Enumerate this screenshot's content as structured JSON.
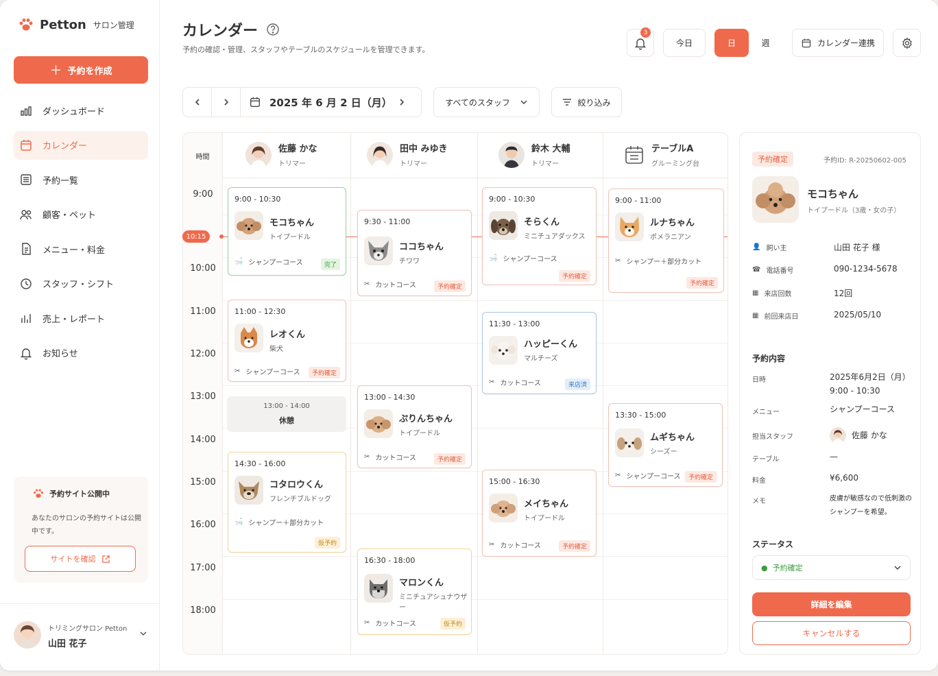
{
  "sidebar": {
    "brand": "Petton",
    "brand_sub": "サロン管理",
    "new_button": "予約を作成",
    "nav": [
      {
        "label": "ダッシュボード"
      },
      {
        "label": "カレンダー"
      },
      {
        "label": "予約一覧"
      },
      {
        "label": "顧客・ペット"
      },
      {
        "label": "メニュー・料金"
      },
      {
        "label": "スタッフ・シフト"
      },
      {
        "label": "売上・レポート"
      },
      {
        "label": "お知らせ"
      }
    ],
    "promo": {
      "title": "予約サイト公開中",
      "desc": "あなたのサロンの予約サイトは公開中です。",
      "button": "サイトを確認"
    },
    "user": {
      "salon": "トリミングサロン Petton",
      "name": "山田 花子"
    }
  },
  "header": {
    "title": "カレンダー",
    "subtitle": "予約の確認・管理、スタッフやテーブルのスケジュールを管理できます。",
    "notif_count": "3",
    "today": "今日",
    "view_day": "日",
    "view_week": "週",
    "calendar_sync": "カレンダー連携"
  },
  "toolbar": {
    "date": "2025 年 6 月 2 日（月）",
    "staff_filter": "すべてのスタッフ",
    "filter": "絞り込み"
  },
  "calendar": {
    "time_header": "時間",
    "now_label": "10:15",
    "times": [
      "9:00",
      "10:00",
      "11:00",
      "12:00",
      "13:00",
      "14:00",
      "15:00",
      "16:00",
      "17:00",
      "18:00"
    ],
    "columns": [
      {
        "name": "佐藤 かな",
        "role": "トリマー"
      },
      {
        "name": "田中 みゆき",
        "role": "トリマー"
      },
      {
        "name": "鈴木 大輔",
        "role": "トリマー"
      },
      {
        "name": "テーブルA",
        "role": "グルーミング台"
      }
    ],
    "break": {
      "time": "13:00 - 14:00",
      "label": "休憩"
    },
    "events": [
      {
        "time": "9:00 - 10:30",
        "pet": "モコちゃん",
        "breed": "トイプードル",
        "menu": "シャンプーコース",
        "status": "完了"
      },
      {
        "time": "11:00 - 12:30",
        "pet": "レオくん",
        "breed": "柴犬",
        "menu": "シャンプーコース",
        "status": "予約確定"
      },
      {
        "time": "14:30 - 16:00",
        "pet": "コタロウくん",
        "breed": "フレンチブルドッグ",
        "menu": "シャンプー＋部分カット",
        "status": "仮予約"
      },
      {
        "time": "9:30 - 11:00",
        "pet": "ココちゃん",
        "breed": "チワワ",
        "menu": "カットコース",
        "status": "予約確定"
      },
      {
        "time": "13:00 - 14:30",
        "pet": "ぷりんちゃん",
        "breed": "トイプードル",
        "menu": "カットコース",
        "status": "予約確定"
      },
      {
        "time": "16:30 - 18:00",
        "pet": "マロンくん",
        "breed": "ミニチュアシュナウザー",
        "menu": "カットコース",
        "status": "仮予約"
      },
      {
        "time": "9:00 - 10:30",
        "pet": "そらくん",
        "breed": "ミニチュアダックス",
        "menu": "シャンプーコース",
        "status": "予約確定"
      },
      {
        "time": "11:30 - 13:00",
        "pet": "ハッピーくん",
        "breed": "マルチーズ",
        "menu": "カットコース",
        "status": "来店済"
      },
      {
        "time": "15:00 - 16:30",
        "pet": "メイちゃん",
        "breed": "トイプードル",
        "menu": "カットコース",
        "status": "予約確定"
      },
      {
        "time": "9:00 - 11:00",
        "pet": "ルナちゃん",
        "breed": "ポメラニアン",
        "menu": "シャンプー＋部分カット",
        "status": "予約確定"
      },
      {
        "time": "13:30 - 15:00",
        "pet": "ムギちゃん",
        "breed": "シーズー",
        "menu": "シャンプーコース",
        "status": "予約確定"
      }
    ]
  },
  "detail": {
    "status_badge": "予約確定",
    "reservation_id": "予約ID: R-20250602-005",
    "pet_name": "モコちゃん",
    "pet_info": "トイプードル（3歳・女の子）",
    "owner_label": "飼い主",
    "owner": "山田 花子 様",
    "phone_label": "電話番号",
    "phone": "090-1234-5678",
    "visits_label": "来店回数",
    "visits": "12回",
    "last_label": "前回来店日",
    "last": "2025/05/10",
    "section_title": "予約内容",
    "date_label": "日時",
    "date_line1": "2025年6月2日（月）",
    "date_line2": "9:00 - 10:30",
    "menu_label": "メニュー",
    "menu": "シャンプーコース",
    "staff_label": "担当スタッフ",
    "staff": "佐藤 かな",
    "table_label": "テーブル",
    "table": "—",
    "price_label": "料金",
    "price": "¥6,600",
    "memo_label": "メモ",
    "memo": "皮膚が敏感なので低刺激のシャンプーを希望。",
    "status_title": "ステータス",
    "status_value": "予約確定",
    "edit_button": "詳細を編集",
    "cancel_button": "キャンセルする"
  },
  "colors": {
    "accent": "#ef6a4c",
    "done": "#3a9c3a",
    "visit": "#3a78c0",
    "tent": "#c4891c"
  }
}
